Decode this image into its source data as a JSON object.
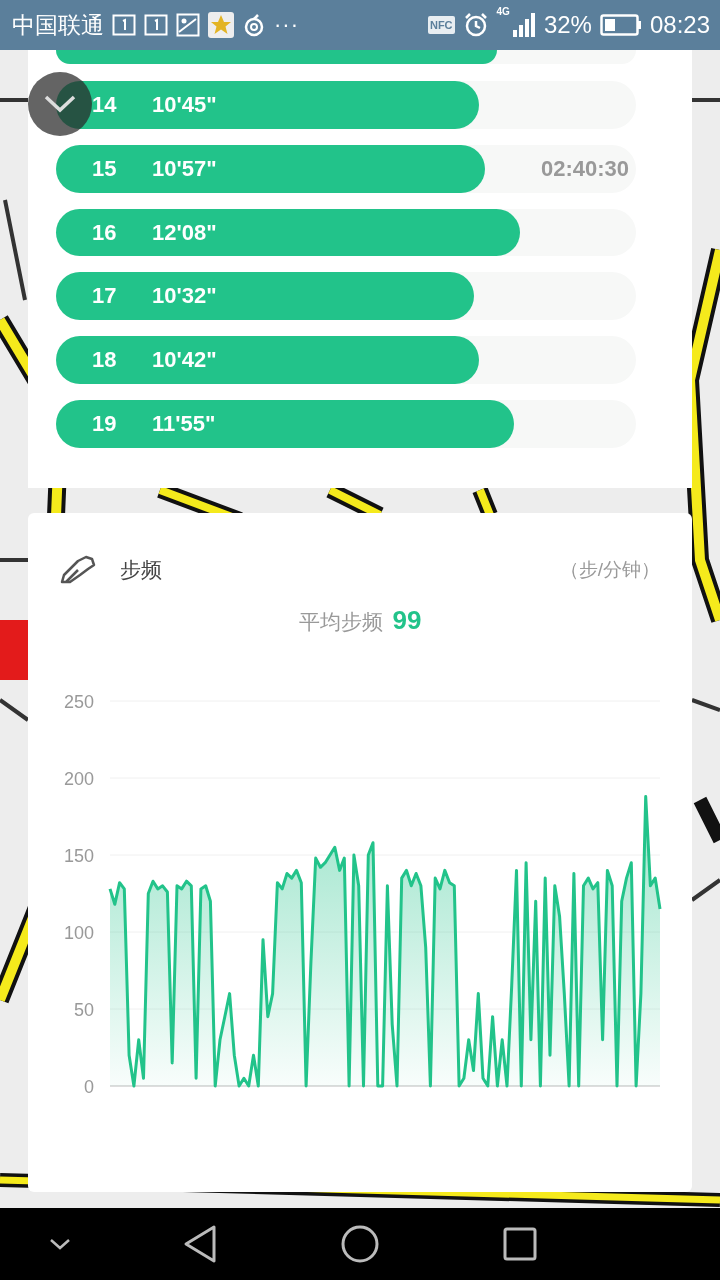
{
  "status_bar": {
    "carrier": "中国联通",
    "more": "···",
    "nfc": "NFC",
    "network": "4G",
    "battery": "32%",
    "time": "08:23"
  },
  "splits": [
    {
      "level": 0.76
    },
    {
      "number": "14",
      "pace": "10'45\"",
      "level": 0.73
    },
    {
      "number": "15",
      "pace": "10'57\"",
      "level": 0.74,
      "time": "02:40:30"
    },
    {
      "number": "16",
      "pace": "12'08\"",
      "level": 0.8
    },
    {
      "number": "17",
      "pace": "10'32\"",
      "level": 0.72
    },
    {
      "number": "18",
      "pace": "10'42\"",
      "level": 0.73
    },
    {
      "number": "19",
      "pace": "11'55\"",
      "level": 0.79
    }
  ],
  "cadence": {
    "title": "步频",
    "unit": "（步/分钟）",
    "average_label": "平均步频",
    "average_value": "99",
    "chart_data": {
      "type": "area",
      "grid": true,
      "ylim": [
        0,
        250
      ],
      "yticks": [
        0,
        50,
        100,
        150,
        200,
        250
      ],
      "series": [
        {
          "color": "#22c38a",
          "values": [
            128,
            118,
            132,
            128,
            20,
            0,
            30,
            5,
            125,
            133,
            128,
            130,
            126,
            15,
            130,
            128,
            133,
            130,
            5,
            128,
            130,
            120,
            0,
            30,
            45,
            60,
            20,
            0,
            5,
            0,
            20,
            0,
            95,
            45,
            60,
            132,
            128,
            138,
            135,
            140,
            132,
            0,
            80,
            148,
            142,
            145,
            150,
            155,
            140,
            148,
            0,
            150,
            130,
            0,
            150,
            158,
            0,
            0,
            130,
            40,
            0,
            135,
            140,
            130,
            138,
            130,
            90,
            0,
            135,
            128,
            140,
            132,
            130,
            0,
            5,
            30,
            10,
            60,
            5,
            0,
            45,
            0,
            30,
            0,
            65,
            140,
            0,
            145,
            30,
            120,
            0,
            135,
            20,
            130,
            110,
            60,
            0,
            138,
            0,
            130,
            135,
            128,
            132,
            30,
            140,
            130,
            0,
            120,
            135,
            145,
            0,
            60,
            188,
            130,
            135,
            115
          ]
        }
      ]
    }
  }
}
